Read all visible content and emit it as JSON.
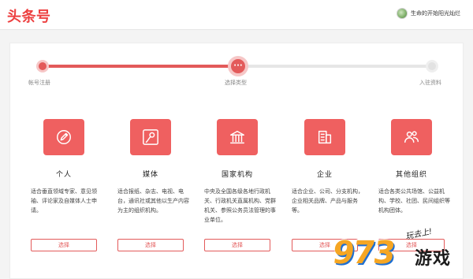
{
  "header": {
    "logo": "头条号",
    "username": "生命的开始阳光灿烂"
  },
  "progress": {
    "fraction": 0.5,
    "current_marker": "···",
    "steps": [
      {
        "label": "帐号注册",
        "state": "done"
      },
      {
        "label": "选择类型",
        "state": "current"
      },
      {
        "label": "入驻资料",
        "state": "todo"
      }
    ]
  },
  "cards": [
    {
      "icon": "pen-icon",
      "title": "个人",
      "desc": "适合垂直领域专家、意见领袖、评论家及自媒体人士申请。",
      "button": "选择"
    },
    {
      "icon": "microphone-icon",
      "title": "媒体",
      "desc": "适合报纸、杂志、电视、电台，通讯社或其他以生产内容为主的组织机构。",
      "button": "选择"
    },
    {
      "icon": "institution-icon",
      "title": "国家机构",
      "desc": "中央及全国各级各地行政机关、行政机关直属机构、党群机关、参照公务员法管理的事业单位。",
      "button": "选择"
    },
    {
      "icon": "building-icon",
      "title": "企业",
      "desc": "适合企业、公司、分支机构，企业相关品牌、产品与服务等。",
      "button": "选择"
    },
    {
      "icon": "group-icon",
      "title": "其他组织",
      "desc": "适合各类公共场馆、公益机构、学校、社团、民间组织等机构团体。",
      "button": "选择"
    }
  ],
  "watermark": {
    "tagline": "玩去上!",
    "number": "973",
    "text": "游戏"
  },
  "colors": {
    "brand": "#ed4040",
    "accent": "#e35a5a"
  }
}
